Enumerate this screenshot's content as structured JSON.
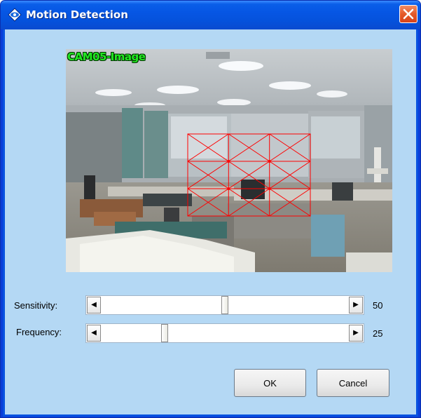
{
  "window": {
    "title": "Motion Detection",
    "title_icon": "camera-eye-icon",
    "close_icon": "close-icon"
  },
  "camera": {
    "label": "CAM05-Image",
    "grid": {
      "rows": 3,
      "cols": 3,
      "color": "#ff0000"
    }
  },
  "sensitivity": {
    "label": "Sensitivity:",
    "value": "50",
    "level": 50,
    "max": 100,
    "left_arrow": "◀",
    "right_arrow": "▶"
  },
  "frequency": {
    "label": "Frequency:",
    "value": "25",
    "level": 25,
    "max": 100,
    "left_arrow": "◀",
    "right_arrow": "▶"
  },
  "buttons": {
    "ok": "OK",
    "cancel": "Cancel"
  },
  "colors": {
    "titlebar": "#0656e4",
    "client_bg": "#b4d8f4",
    "label_green": "#22e822",
    "grid_red": "#ff0000"
  }
}
